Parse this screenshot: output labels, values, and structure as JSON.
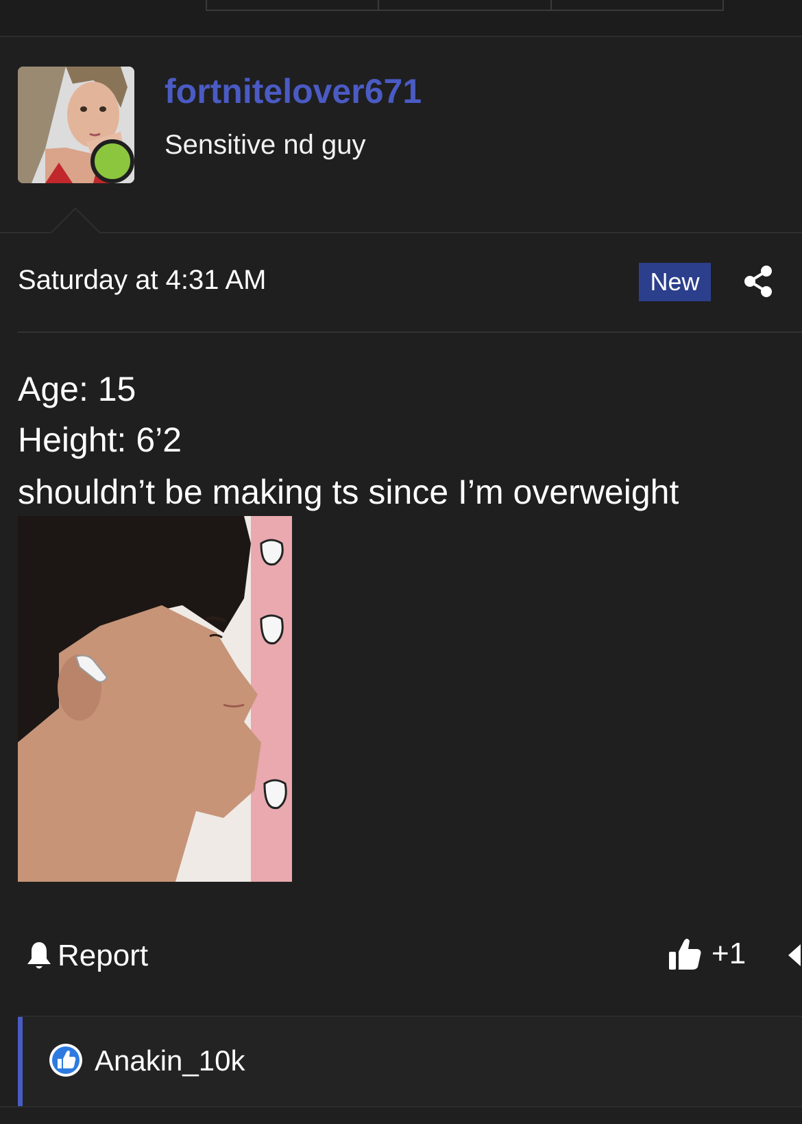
{
  "user": {
    "username": "fortnitelover671",
    "title": "Sensitive nd guy",
    "status": "online",
    "avatar_icon": "profile-photo"
  },
  "post": {
    "date": "Saturday at 4:31 AM",
    "badge": "New",
    "lines": [
      "Age: 15",
      "Height: 6’2",
      "shouldn’t be making ts since I’m overweight"
    ],
    "image_icon": "attached-photo"
  },
  "actions": {
    "report_label": "Report",
    "like_count": "+1"
  },
  "reactions": {
    "users": [
      "Anakin_10k"
    ]
  },
  "colors": {
    "background": "#1f1f20",
    "username": "#4a5bc4",
    "badge": "#2c3f8c",
    "online": "#8cc63e",
    "like": "#2d7be0"
  }
}
